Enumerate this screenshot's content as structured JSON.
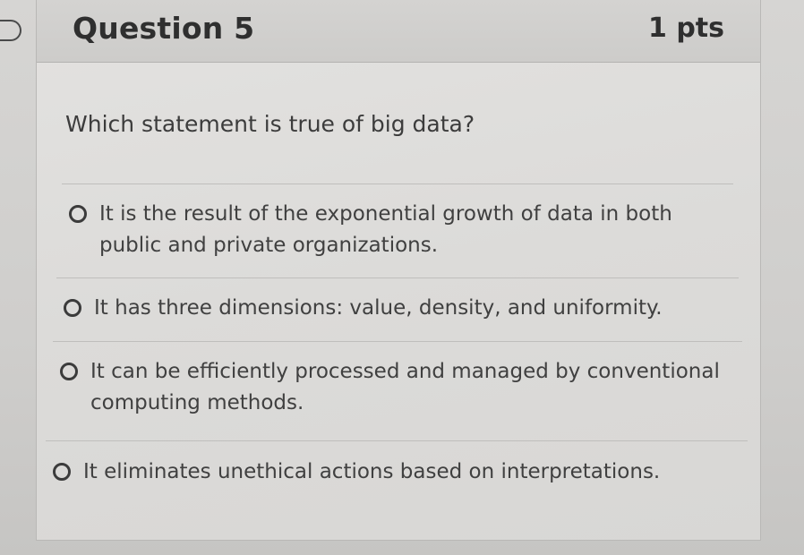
{
  "question": {
    "title": "Question 5",
    "points": "1 pts",
    "prompt": "Which statement is true of big data?"
  },
  "answers": [
    {
      "line1": "It is the result of the exponential growth of data in both",
      "line2": "public and private organizations."
    },
    {
      "line1": "It has three dimensions: value, density, and uniformity.",
      "line2": ""
    },
    {
      "line1": "It can be efficiently processed and managed by conventional",
      "line2": "computing methods."
    },
    {
      "line1": "It eliminates unethical actions based on interpretations.",
      "line2": ""
    }
  ]
}
